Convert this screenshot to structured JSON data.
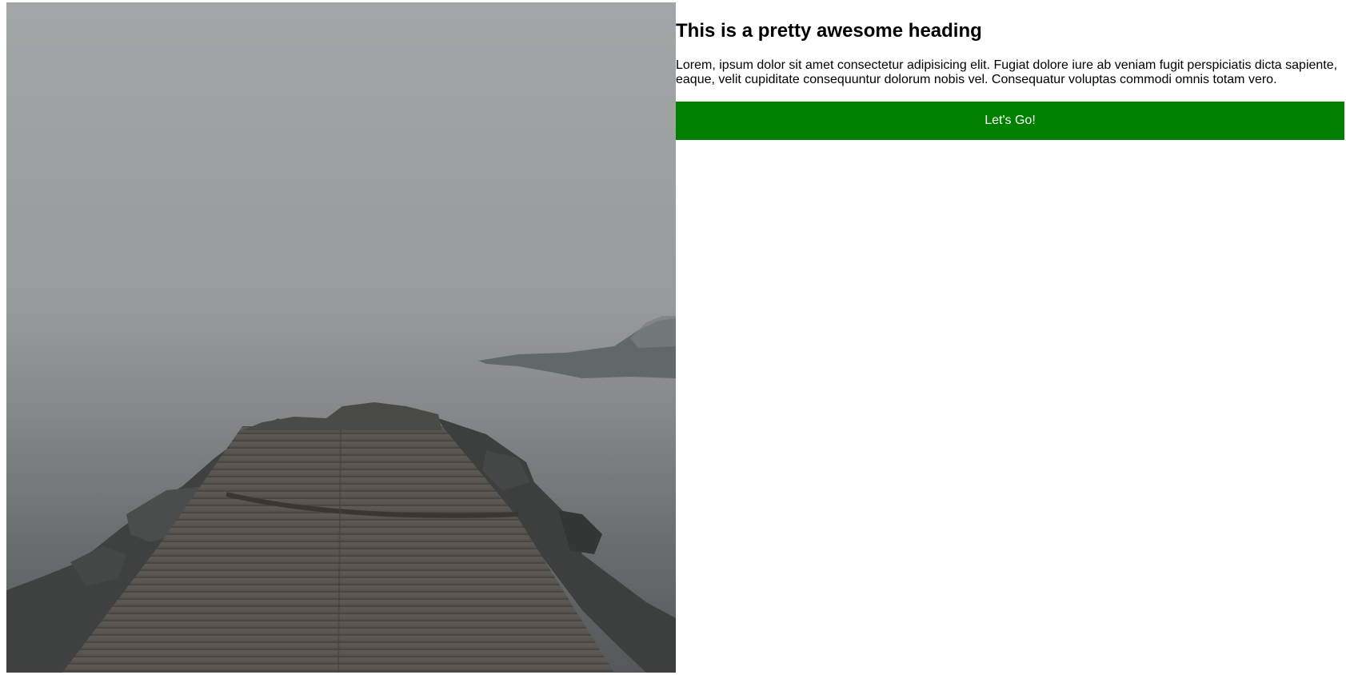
{
  "hero": {
    "image_name": "foggy-pier-photo"
  },
  "content": {
    "heading": "This is a pretty awesome heading",
    "paragraph": "Lorem, ipsum dolor sit amet consectetur adipisicing elit. Fugiat dolore iure ab veniam fugit perspiciatis dicta sapiente, eaque, velit cupiditate consequuntur dolorum nobis vel. Consequatur voluptas commodi omnis totam vero.",
    "button_label": "Let's Go!"
  },
  "colors": {
    "button_background": "#008000",
    "button_text": "#ffffff",
    "heading_text": "#000000"
  }
}
